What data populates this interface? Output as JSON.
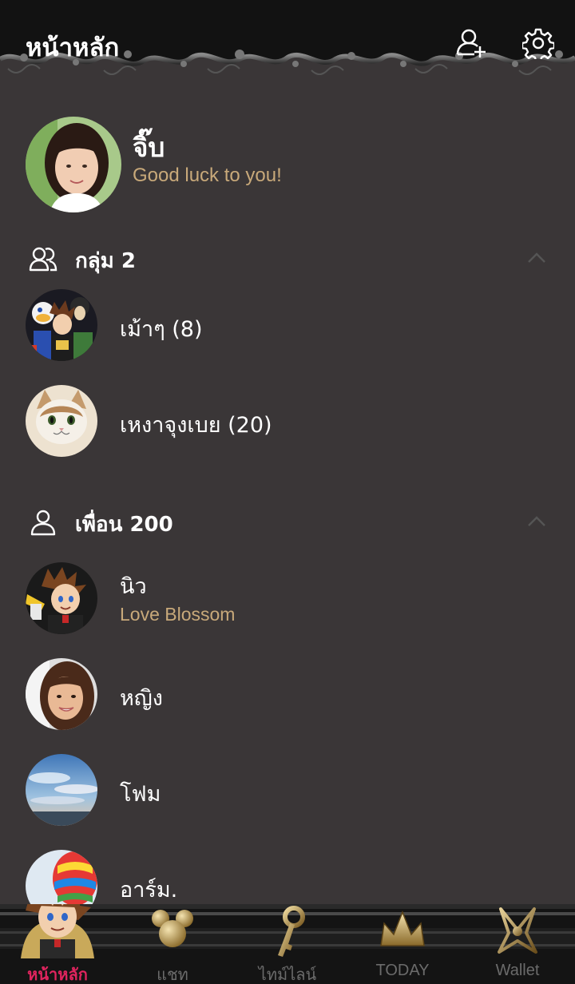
{
  "header": {
    "title": "หน้าหลัก",
    "actions": [
      {
        "icon": "add-friend-icon"
      },
      {
        "icon": "gear-icon"
      }
    ]
  },
  "profile": {
    "name": "จิ๊บ",
    "status": "Good luck to you!"
  },
  "groups": {
    "title": "กลุ่ม 2",
    "icon": "group-icon",
    "items": [
      {
        "name": "เม้าๆ (8)"
      },
      {
        "name": "เหงาจุงเบย (20)"
      }
    ]
  },
  "friends": {
    "title": "เพื่อน 200",
    "icon": "person-icon",
    "items": [
      {
        "name": "นิว",
        "status": "Love Blossom"
      },
      {
        "name": "หญิง"
      },
      {
        "name": "โฟม"
      },
      {
        "name": "อาร์ม."
      }
    ]
  },
  "tabs": [
    {
      "label": "หน้าหลัก",
      "icon": "character-icon",
      "active": true
    },
    {
      "label": "แชท",
      "icon": "mouse-ears-icon"
    },
    {
      "label": "ไทม์ไลน์",
      "icon": "key-icon"
    },
    {
      "label": "TODAY",
      "icon": "crown-icon"
    },
    {
      "label": "Wallet",
      "icon": "emblem-icon"
    }
  ],
  "colors": {
    "background": "#3a3637",
    "header": "#121212",
    "accent_status": "#c8a97a",
    "active_tab": "#e0245e",
    "inactive_tab": "#6b6b6b"
  }
}
